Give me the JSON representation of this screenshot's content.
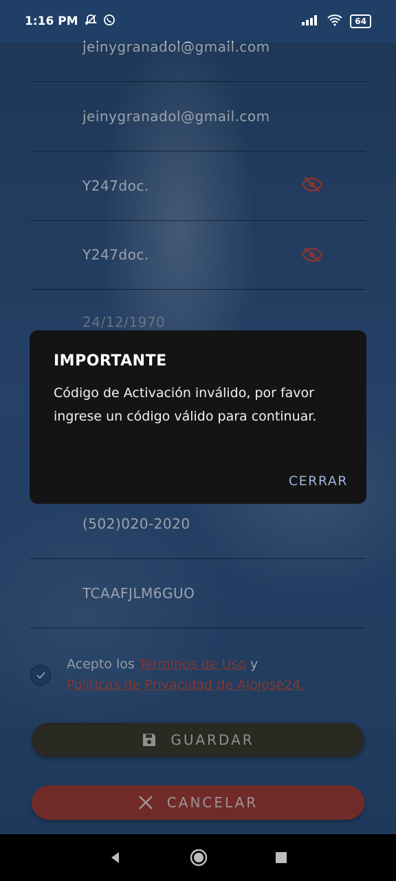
{
  "status_bar": {
    "time": "1:16 PM",
    "battery": "64"
  },
  "form": {
    "email": "jeinygranadol@gmail.com",
    "email_confirm": "jeinygranadol@gmail.com",
    "password": "Y247doc.",
    "password_confirm": "Y247doc.",
    "birthdate": "24/12/1970",
    "phone": "(502)020-2020",
    "activation_code": "TCAAFJLM6GUO"
  },
  "terms": {
    "prefix": "Acepto los ",
    "terms_link": "Términos de Uso",
    "connector": " y",
    "privacy_link": "Políticas de Privacidad de Alójosé24."
  },
  "buttons": {
    "save": "GUARDAR",
    "cancel": "CANCELAR"
  },
  "dialog": {
    "title": "IMPORTANTE",
    "message": "Código de Activación inválido, por favor ingrese un código válido para continuar.",
    "close": "CERRAR"
  },
  "colors": {
    "accent_red": "#c64a3a",
    "save_button": "#3d3523",
    "cancel_button": "#a8382d"
  }
}
